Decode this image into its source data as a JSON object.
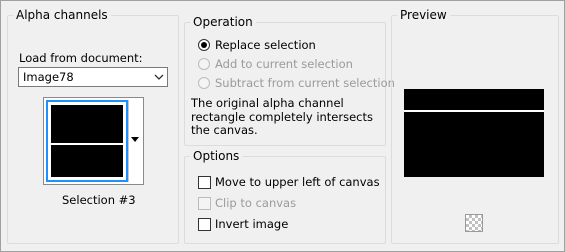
{
  "alpha_channels": {
    "title": "Alpha channels",
    "load_from_label": "Load from document:",
    "document_value": "Image78",
    "selection_caption": "Selection #3"
  },
  "operation": {
    "title": "Operation",
    "options": [
      {
        "label": "Replace selection",
        "selected": true,
        "enabled": true
      },
      {
        "label": "Add to current selection",
        "selected": false,
        "enabled": false
      },
      {
        "label": "Subtract from current selection",
        "selected": false,
        "enabled": false
      }
    ],
    "description": "The original alpha channel rectangle completely intersects the canvas."
  },
  "options": {
    "title": "Options",
    "items": [
      {
        "label": "Move to upper left of canvas",
        "checked": false,
        "enabled": true
      },
      {
        "label": "Clip to canvas",
        "checked": false,
        "enabled": false
      },
      {
        "label": "Invert image",
        "checked": false,
        "enabled": true
      }
    ]
  },
  "preview": {
    "title": "Preview",
    "icon": "transparency-checker-icon"
  },
  "colors": {
    "selection_border": "#1e90ff",
    "background": "#f0f0f0"
  }
}
